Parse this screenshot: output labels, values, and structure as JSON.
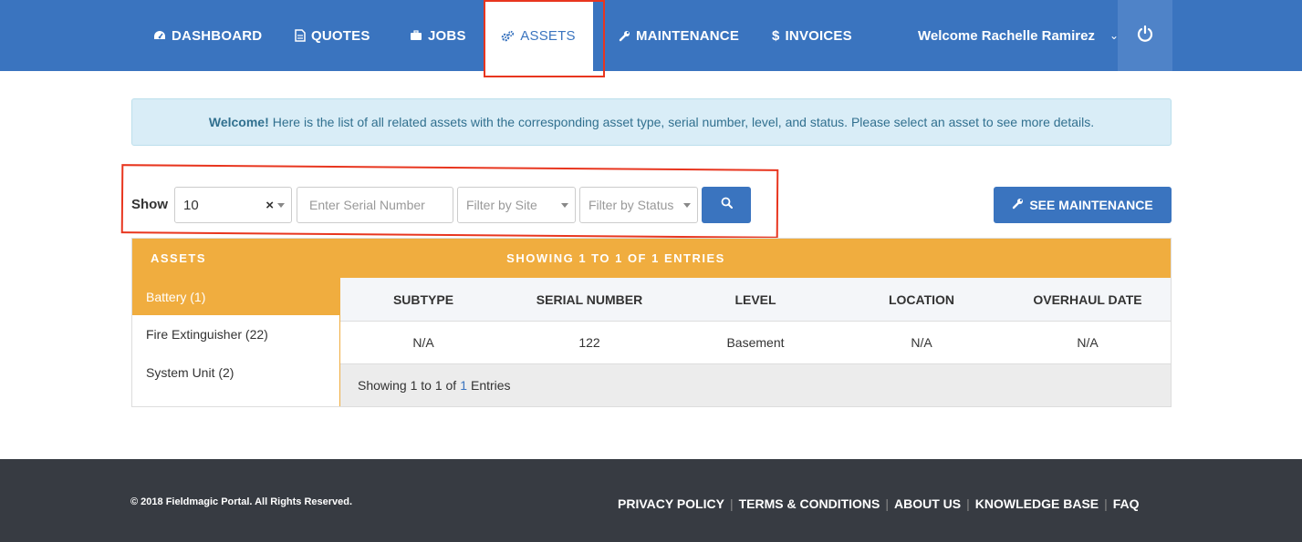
{
  "nav": {
    "items": [
      {
        "label": "DASHBOARD",
        "icon": "dashboard-icon"
      },
      {
        "label": "QUOTES",
        "icon": "document-icon"
      },
      {
        "label": "JOBS",
        "icon": "briefcase-icon"
      },
      {
        "label": "ASSETS",
        "icon": "gears-icon",
        "active": true
      },
      {
        "label": "MAINTENANCE",
        "icon": "wrench-icon"
      },
      {
        "label": "INVOICES",
        "icon": "dollar-icon"
      }
    ],
    "user_menu_label": "Welcome Rachelle Ramirez",
    "power_icon": "power-icon"
  },
  "alert": {
    "strong": "Welcome!",
    "text": "Here is the list of all related assets with the corresponding asset type, serial number, level, and status. Please select an asset to see more details."
  },
  "filters": {
    "show_label": "Show",
    "page_size": "10",
    "clear_glyph": "×",
    "serial_placeholder": "Enter Serial Number",
    "site_placeholder": "Filter by Site",
    "status_placeholder": "Filter by Status",
    "search_icon": "search-icon"
  },
  "see_maintenance_label": "SEE MAINTENANCE",
  "panel": {
    "assets_heading": "ASSETS",
    "showing_heading": "SHOWING 1 TO 1 OF 1 ENTRIES",
    "asset_types": [
      {
        "label": "Battery (1)",
        "active": true
      },
      {
        "label": "Fire Extinguisher (22)"
      },
      {
        "label": "System Unit (2)"
      }
    ],
    "columns": [
      "SUBTYPE",
      "SERIAL NUMBER",
      "LEVEL",
      "LOCATION",
      "OVERHAUL DATE"
    ],
    "rows": [
      [
        "N/A",
        "122",
        "Basement",
        "N/A",
        "N/A"
      ]
    ],
    "footer": {
      "prefix": "Showing 1 to 1 of",
      "count": "1",
      "suffix": "Entries"
    }
  },
  "footer": {
    "copyright": "© 2018 Fieldmagic Portal. All Rights Reserved.",
    "links": [
      "PRIVACY POLICY",
      "TERMS & CONDITIONS",
      "ABOUT US",
      "KNOWLEDGE BASE",
      "FAQ"
    ]
  },
  "colors": {
    "primary": "#3a74bf",
    "accent": "#f0ad3f",
    "footer": "#373b42",
    "highlight": "#e8361f"
  }
}
